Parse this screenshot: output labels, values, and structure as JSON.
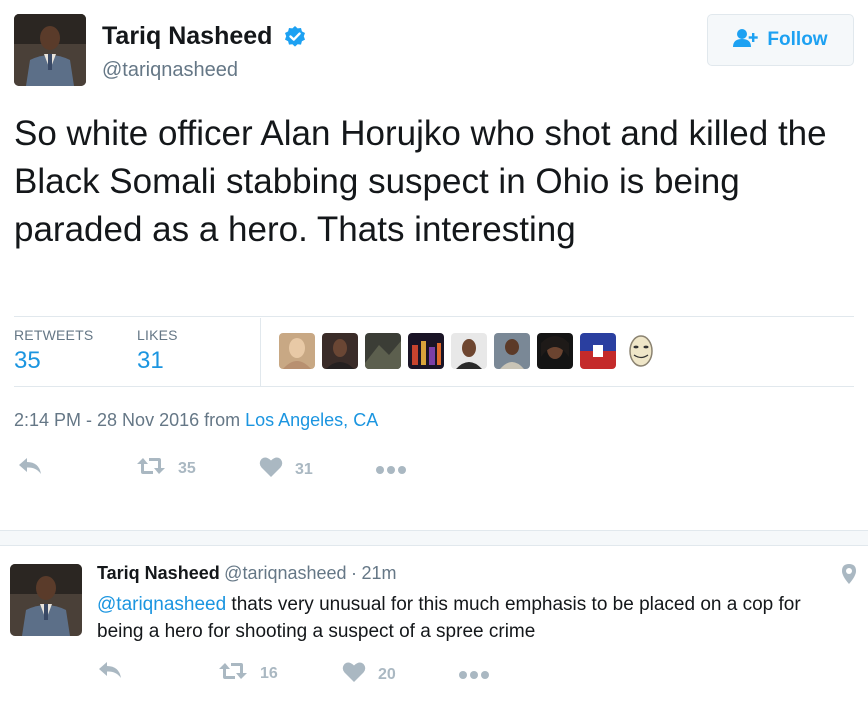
{
  "tweet": {
    "author_name": "Tariq Nasheed",
    "author_handle": "@tariqnasheed",
    "follow_label": "Follow",
    "text": "So white officer  Alan Horujko who shot and killed the Black Somali stabbing suspect in Ohio is being paraded as a hero. Thats interesting",
    "stats": {
      "retweets_label": "RETWEETS",
      "retweets_value": "35",
      "likes_label": "LIKES",
      "likes_value": "31"
    },
    "timestamp": "2:14 PM - 28 Nov 2016 from ",
    "location": "Los Angeles, CA",
    "actions": {
      "retweet_count": "35",
      "like_count": "31"
    }
  },
  "reply": {
    "author_name": "Tariq Nasheed",
    "author_handle": "@tariqnasheed",
    "separator": "·",
    "time": "21m",
    "mention": "@tariqnasheed",
    "text": " thats very unusual for this much emphasis to be placed on a cop for being a hero for shooting a suspect of a spree crime",
    "actions": {
      "retweet_count": "16",
      "like_count": "20"
    }
  },
  "colors": {
    "accent": "#1b95e0",
    "verified": "#1da1f2",
    "muted": "#657786",
    "icon": "#aab8c2"
  },
  "icons": [
    "verified-badge-icon",
    "follow-user-icon",
    "reply-icon",
    "retweet-icon",
    "heart-icon",
    "more-icon",
    "location-pin-icon"
  ]
}
